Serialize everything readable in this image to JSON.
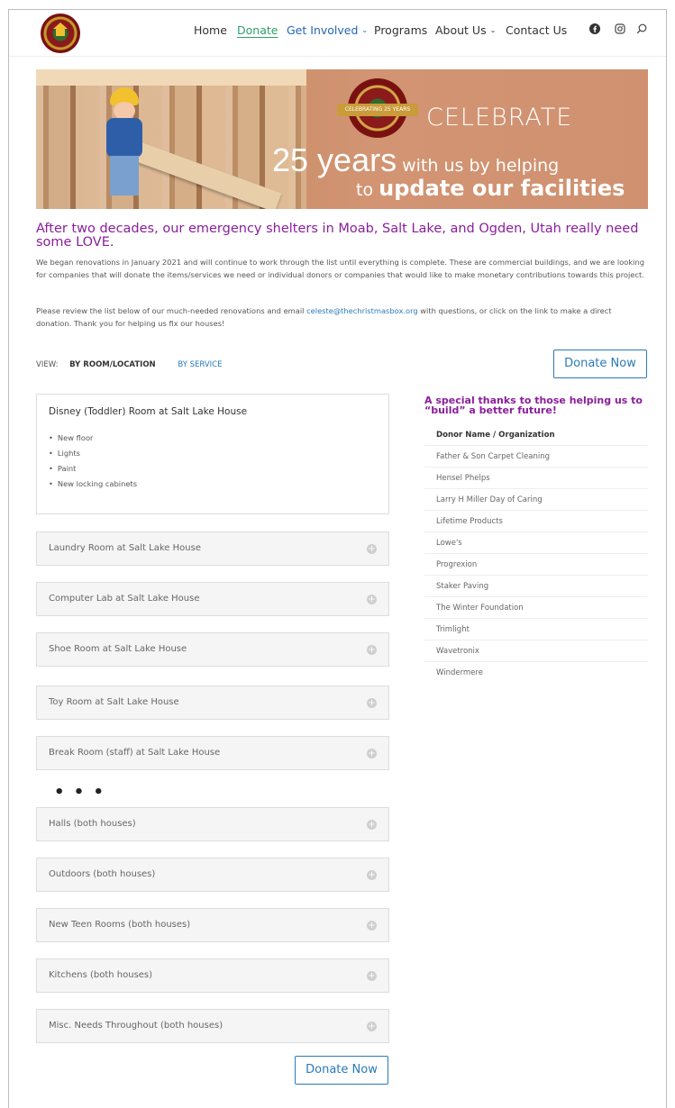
{
  "nav": {
    "items": [
      {
        "label": "Home"
      },
      {
        "label": "Donate"
      },
      {
        "label": "Get Involved"
      },
      {
        "label": "Programs"
      },
      {
        "label": "About Us"
      },
      {
        "label": "Contact Us"
      }
    ],
    "caret": "⌄",
    "icons": [
      "facebook-icon",
      "instagram-icon",
      "search-icon"
    ]
  },
  "banner": {
    "seal_text": "CELEBRATING 25 YEARS",
    "celebrate": "CELEBRATE",
    "years_big": "25 years",
    "years_small": " with us by helping",
    "update_small": "to ",
    "update_bold": "update our facilities"
  },
  "intro": {
    "headline": "After two decades, our emergency shelters in Moab, Salt Lake, and Ogden, Utah really need some LOVE.",
    "para1": "We began renovations in January 2021 and will continue to work through the list until everything is complete. These are commercial buildings, and we are looking for companies that will donate the items/services we need or individual donors or companies that would like to make monetary contributions towards this project.",
    "para2_before": "Please review the list below of our much-needed renovations and email ",
    "email": "celeste@thechristmasbox.org",
    "para2_after": " with questions, or click on the link to make a direct donation. Thank you for helping us fix our houses!"
  },
  "view": {
    "label": "VIEW:",
    "active": "BY ROOM/LOCATION",
    "other": "BY SERVICE"
  },
  "donate_button": "Donate Now",
  "rooms": {
    "open": {
      "title": "Disney (Toddler) Room at Salt Lake House",
      "items": [
        "New floor",
        "Lights",
        "Paint",
        "New locking cabinets"
      ]
    },
    "closed_top": [
      "Laundry Room at Salt Lake House",
      "Computer Lab at Salt Lake House",
      "Shoe Room at Salt Lake House",
      "Toy Room at Salt Lake House",
      "Break Room (staff) at Salt Lake House"
    ],
    "ellipsis": "• • •",
    "closed_bottom": [
      "Halls (both houses)",
      "Outdoors (both houses)",
      "New Teen Rooms (both houses)",
      "Kitchens (both houses)",
      "Misc. Needs Throughout (both houses)"
    ]
  },
  "donors": {
    "heading": "A special thanks to those helping us to “build” a better future!",
    "column": "Donor Name / Organization",
    "list": [
      "Father & Son Carpet Cleaning",
      "Hensel Phelps",
      "Larry H Miller Day of Caring",
      "Lifetime Products",
      "Lowe's",
      "Progrexion",
      "Staker Paving",
      "The Winter Foundation",
      "Trimlight",
      "Wavetronix",
      "Windermere"
    ]
  }
}
